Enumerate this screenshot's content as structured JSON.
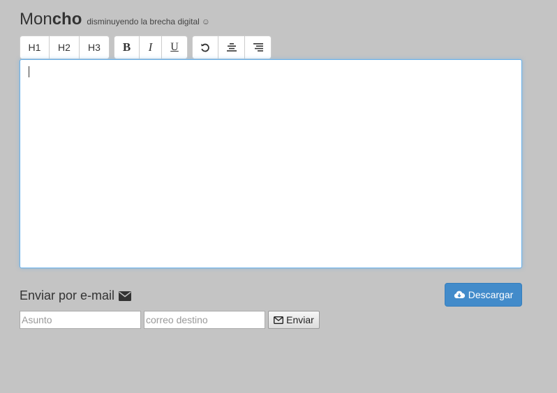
{
  "header": {
    "brand_part1": "Mon",
    "brand_part2": "cho",
    "tagline": "disminuyendo la brecha digital",
    "smiley": "☺"
  },
  "toolbar": {
    "headings": [
      "H1",
      "H2",
      "H3"
    ],
    "format": {
      "bold": "B",
      "italic": "I",
      "underline": "U"
    },
    "icons": [
      "undo-icon",
      "align-center-icon",
      "align-right-icon"
    ]
  },
  "editor": {
    "content": ""
  },
  "email": {
    "heading": "Enviar por e-mail",
    "subject_placeholder": "Asunto",
    "recipient_placeholder": "correo destino",
    "send_label": "Enviar"
  },
  "download": {
    "label": "Descargar"
  },
  "colors": {
    "background": "#c4c4c4",
    "primary": "#428bca",
    "editor_focus": "#66afe9"
  }
}
